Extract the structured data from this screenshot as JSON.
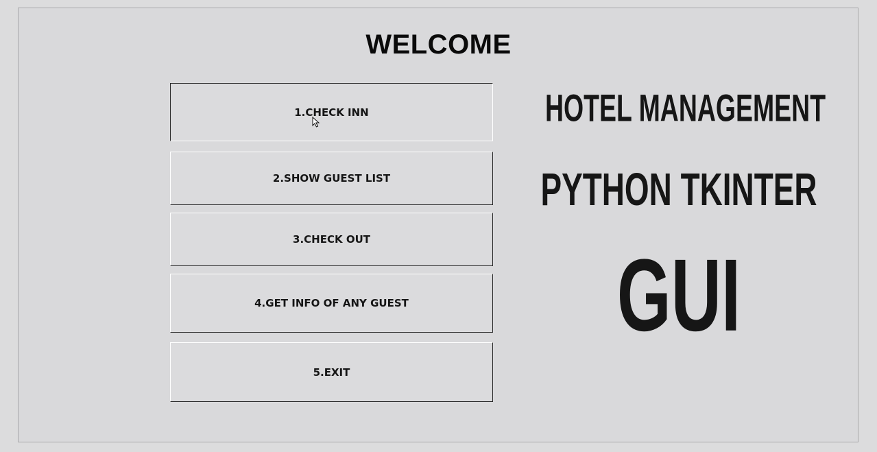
{
  "window": {
    "heading": "WELCOME"
  },
  "menu": {
    "buttons": [
      {
        "label": "1.CHECK INN"
      },
      {
        "label": "2.SHOW GUEST LIST"
      },
      {
        "label": "3.CHECK OUT"
      },
      {
        "label": "4.GET INFO OF ANY GUEST"
      },
      {
        "label": "5.EXIT"
      }
    ]
  },
  "banner": {
    "line1": "HOTEL MANAGEMENT",
    "line2": "PYTHON TKINTER",
    "line3": "GUI"
  },
  "colors": {
    "background": "#dcdcdd",
    "text": "#161616"
  },
  "icons": {
    "cursor": "mouse-pointer-icon"
  }
}
